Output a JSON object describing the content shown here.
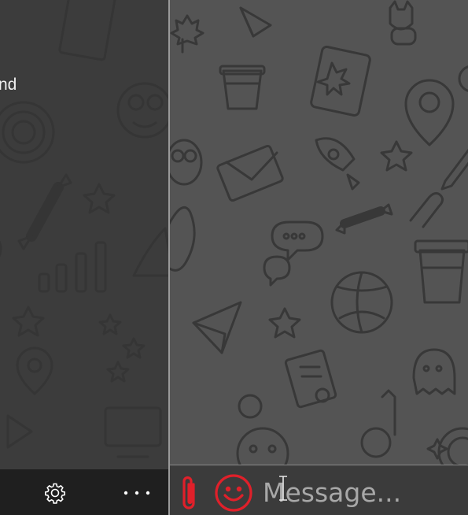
{
  "sidebar": {
    "partial_text": "nd",
    "bottom_bar": {
      "settings_icon": "gear-icon",
      "more_icon": "ellipsis-icon"
    }
  },
  "chat": {
    "background": "doodle-pattern",
    "composer": {
      "placeholder": "Message...",
      "value": "",
      "attach_icon": "paperclip-icon",
      "emoji_icon": "smiley-icon"
    }
  },
  "colors": {
    "accent": "#e0202a",
    "sidebar_bg": "#3c3c3c",
    "chat_bg": "#545454",
    "bottom_bar_bg": "#1f1f1f",
    "composer_bg": "#3b3b3b",
    "doodle_stroke": "#333333"
  }
}
